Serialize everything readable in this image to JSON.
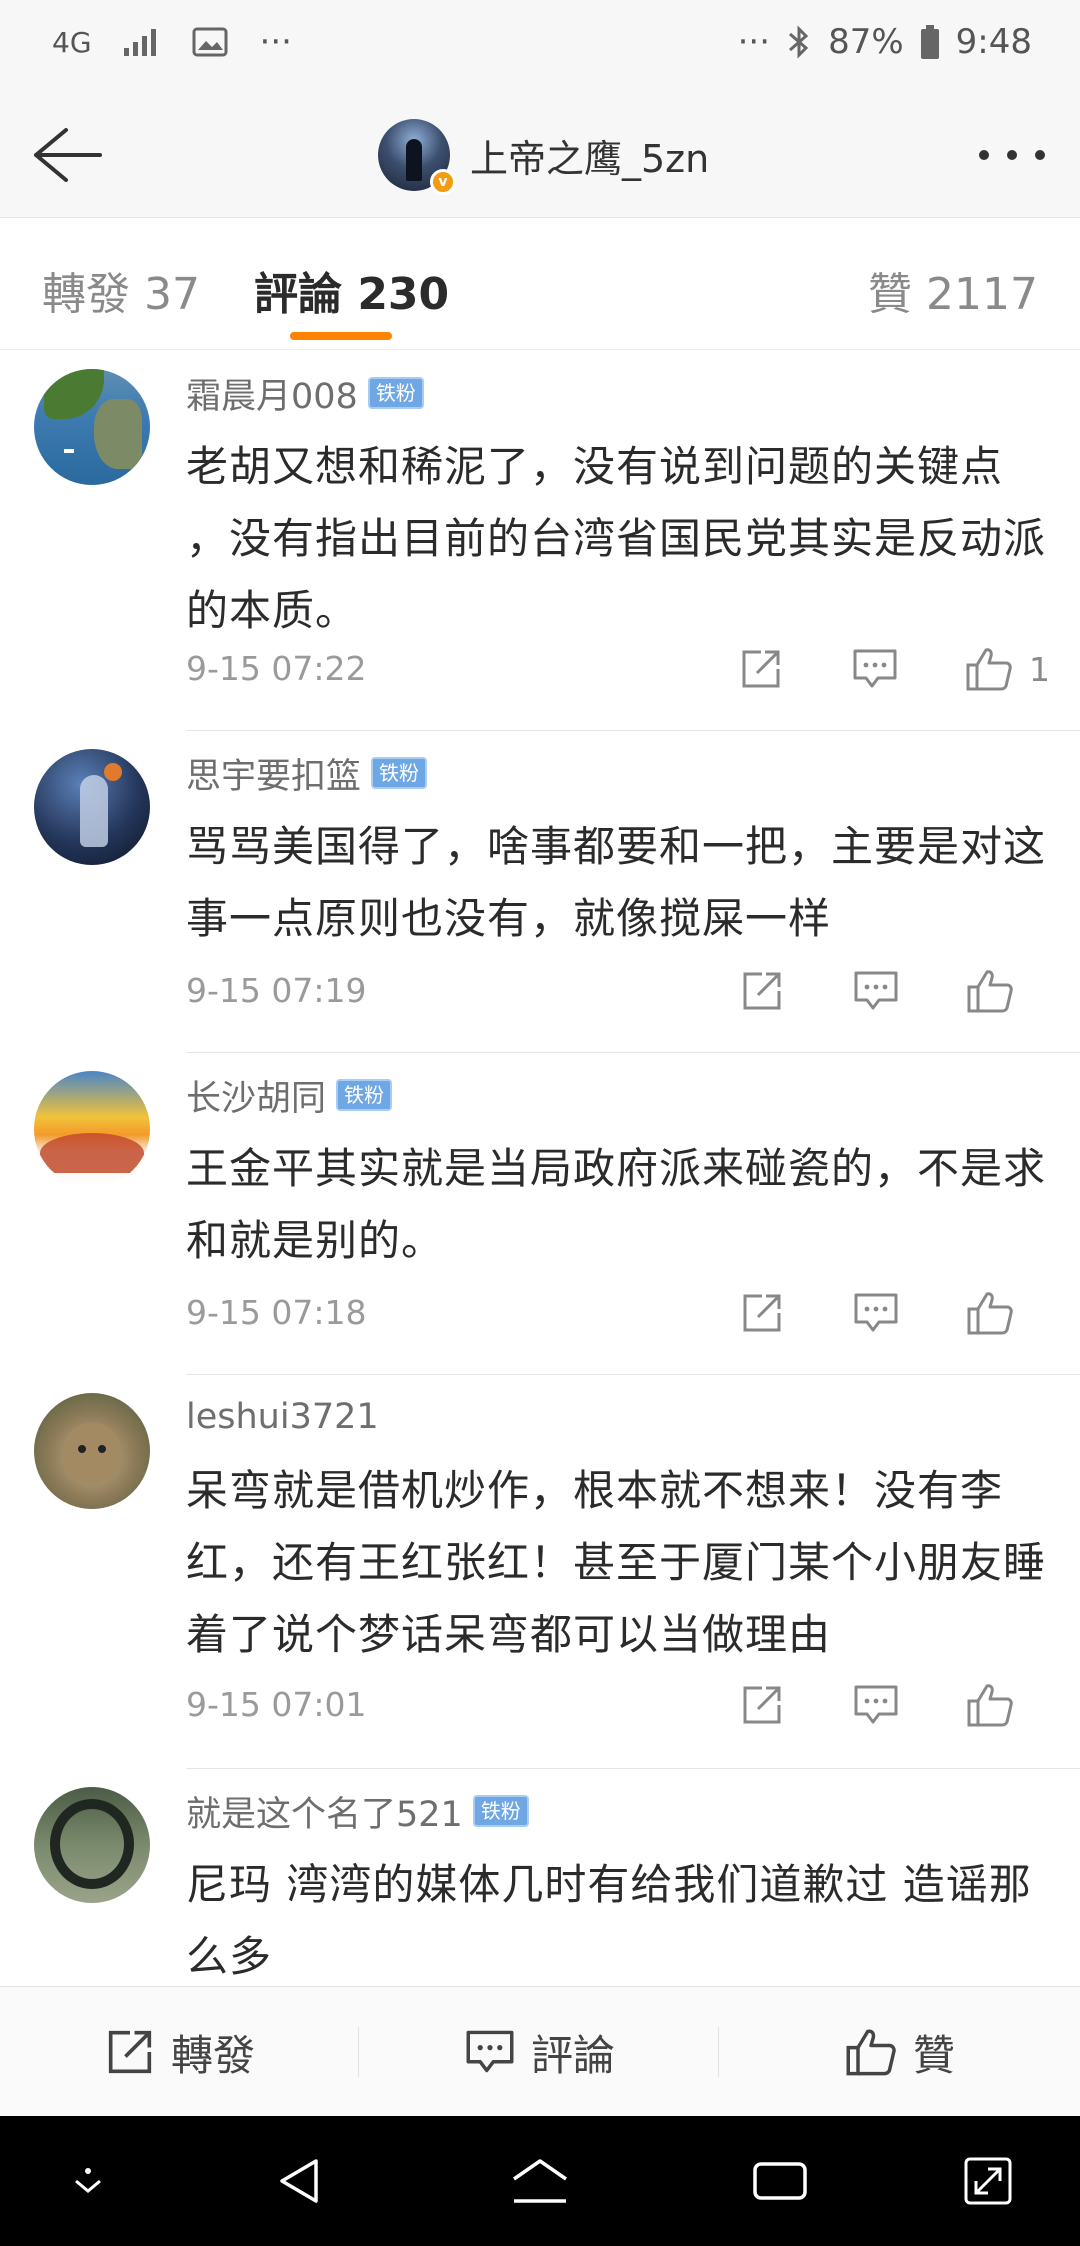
{
  "status_bar": {
    "network": "4G",
    "dots_left": "···",
    "dots_right": "···",
    "battery": "87%",
    "time": "9:48"
  },
  "header": {
    "author_name": "上帝之鹰_5zn",
    "verified_badge": "v"
  },
  "tabs": {
    "repost": "轉發 37",
    "comments": "評論 230",
    "likes": "贊 2117"
  },
  "comments": [
    {
      "username": "霜晨月008",
      "badge": "铁粉",
      "text": "老胡又想和稀泥了，没有说到问题的关键点 ，没有指出目前的台湾省国民党其实是反动派的本质。",
      "time": "9-15 07:22",
      "likes": "1"
    },
    {
      "username": "思宇要扣篮",
      "badge": "铁粉",
      "text": "骂骂美国得了，啥事都要和一把，主要是对这事一点原则也没有，就像搅屎一样",
      "time": "9-15 07:19",
      "likes": ""
    },
    {
      "username": "长沙胡同",
      "badge": "铁粉",
      "text": "王金平其实就是当局政府派来碰瓷的，不是求和就是别的。",
      "time": "9-15 07:18",
      "likes": ""
    },
    {
      "username": "leshui3721",
      "badge": "",
      "text": "呆弯就是借机炒作，根本就不想来！没有李红，还有王红张红！甚至于厦门某个小朋友睡着了说个梦话呆弯都可以当做理由",
      "time": "9-15 07:01",
      "likes": ""
    },
    {
      "username": "就是这个名了521",
      "badge": "铁粉",
      "text": "尼玛 湾湾的媒体几时有给我们道歉过 造谣那么多",
      "time": "",
      "likes": ""
    }
  ],
  "action_bar": {
    "repost": "轉發",
    "comment": "評論",
    "like": "贊"
  },
  "colors": {
    "accent": "#ff8200",
    "fan_badge": "#6fa7e5",
    "verified": "#f39c12"
  },
  "icons": {
    "back": "arrow-left-icon",
    "more": "more-dots-icon",
    "share": "share-icon",
    "comment": "comment-icon",
    "like": "thumbs-up-icon"
  }
}
